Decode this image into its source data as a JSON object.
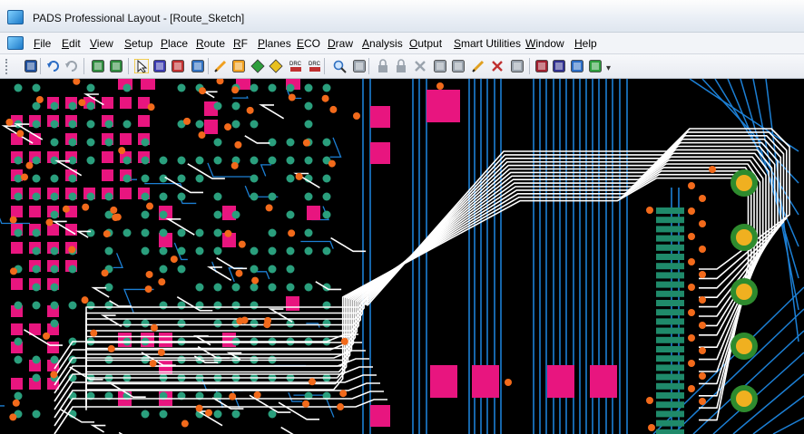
{
  "window": {
    "title": "PADS Professional Layout - [Route_Sketch]"
  },
  "menubar": {
    "items": [
      "File",
      "Edit",
      "View",
      "Setup",
      "Place",
      "Route",
      "RF",
      "Planes",
      "ECO",
      "Draw",
      "Analysis",
      "Output",
      "Smart Utilities",
      "Window",
      "Help"
    ]
  },
  "toolbar": {
    "buttons": [
      {
        "name": "save-icon",
        "color": "#1f4f9c"
      },
      {
        "name": "undo-icon",
        "color": "#2b6cc4"
      },
      {
        "name": "redo-icon",
        "color": "#9aa3ad"
      },
      {
        "name": "display-control-icon",
        "color": "#2e8b3d"
      },
      {
        "name": "view-board-icon",
        "color": "#2e8b3d"
      },
      {
        "name": "select-mode-icon",
        "color": "#f0c020"
      },
      {
        "name": "place-part-icon",
        "color": "#3a3ab0"
      },
      {
        "name": "route-icon",
        "color": "#c03030"
      },
      {
        "name": "sketch-route-icon",
        "color": "#3070c0"
      },
      {
        "name": "folder-open-icon",
        "color": "#f0a020"
      },
      {
        "name": "properties-icon",
        "color": "#f0a020"
      },
      {
        "name": "diamond-green-icon",
        "color": "#2e9e3d"
      },
      {
        "name": "diamond-yellow-icon",
        "color": "#e8c020"
      },
      {
        "name": "drc-icon",
        "color": "#c03030"
      },
      {
        "name": "drc-check-icon",
        "color": "#c03030"
      },
      {
        "name": "find-icon",
        "color": "#3070c0"
      },
      {
        "name": "print-icon",
        "color": "#9aa3ad"
      },
      {
        "name": "lock-icon",
        "color": "#9aa3ad"
      },
      {
        "name": "unlock-icon",
        "color": "#9aa3ad"
      },
      {
        "name": "delete-icon",
        "color": "#9aa3ad"
      },
      {
        "name": "grid-icon",
        "color": "#9aa3ad"
      },
      {
        "name": "grid-snap-icon",
        "color": "#9aa3ad"
      },
      {
        "name": "pen-icon",
        "color": "#e0a020"
      },
      {
        "name": "cut-net-icon",
        "color": "#c03030"
      },
      {
        "name": "unroute-icon",
        "color": "#9aa3ad"
      },
      {
        "name": "stackup-icon",
        "color": "#a02030"
      },
      {
        "name": "layers-icon",
        "color": "#303090"
      },
      {
        "name": "copy-icon",
        "color": "#2b6cc4"
      },
      {
        "name": "batch-icon",
        "color": "#2e9e3d"
      }
    ]
  },
  "board": {
    "background": "#000000",
    "pad_color": "#e8157f",
    "smd_pad_color": "#1f8a6a",
    "via_color": "#f26a1b",
    "trace_color": "#ffffff",
    "blue_trace_color": "#1c7fd4",
    "hole_ring_color": "#2e8b2e",
    "hole_center_color": "#f0b020",
    "teal_dot_color": "#2a9f7d"
  }
}
